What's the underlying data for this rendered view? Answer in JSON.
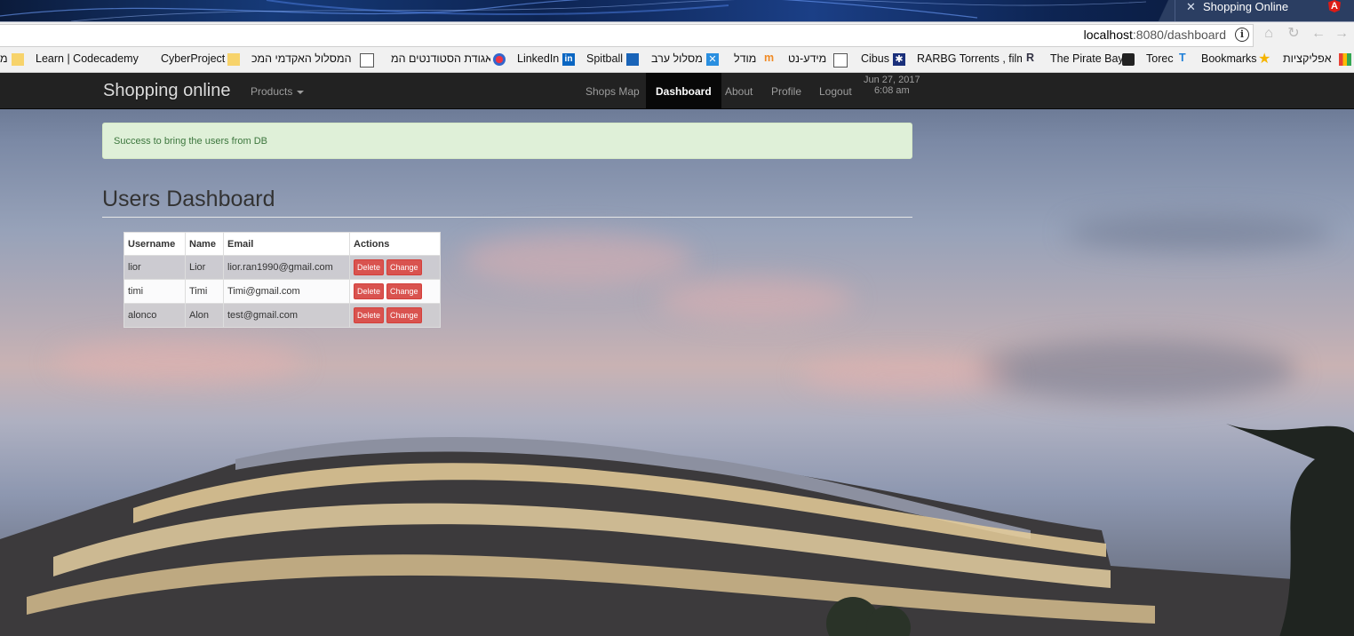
{
  "browser": {
    "tab_title": "Shopping Online",
    "tab_icon": "angular-icon",
    "url_host": "localhost",
    "url_rest": ":8080/dashboard",
    "bookmarks": [
      {
        "label": "אפליקציות",
        "icon": "apps-grid-icon"
      },
      {
        "label": "Bookmarks",
        "icon": "star-icon"
      },
      {
        "label": "Torec",
        "icon": "torec-icon"
      },
      {
        "label": "The Pirate Bay",
        "icon": "pirate-bay-icon"
      },
      {
        "label": "RARBG Torrents , film",
        "icon": "rarbg-icon"
      },
      {
        "label": "Cibus",
        "icon": "cibus-icon"
      },
      {
        "label": "מידע-נט",
        "icon": "puzzle-icon"
      },
      {
        "label": "מודל",
        "icon": "moodle-icon"
      },
      {
        "label": "מסלול ערב",
        "icon": "x-icon"
      },
      {
        "label": "Spitball",
        "icon": "spitball-icon"
      },
      {
        "label": "LinkedIn",
        "icon": "linkedin-icon"
      },
      {
        "label": "אגודת הסטודנטים המ",
        "icon": "student-icon"
      },
      {
        "label": "המסלול האקדמי המכ",
        "icon": "puzzle-icon"
      },
      {
        "label": "CyberProject",
        "icon": "folder-icon"
      },
      {
        "label": "Learn | Codecademy",
        "icon": "folder-icon"
      },
      {
        "label": "מ",
        "icon": "folder-icon"
      }
    ]
  },
  "navbar": {
    "brand": "Shopping online",
    "products": "Products",
    "links": {
      "shops_map": "Shops Map",
      "dashboard": "Dashboard",
      "about": "About",
      "profile": "Profile",
      "logout": "Logout"
    },
    "date": "Jun 27, 2017",
    "time": "6:08 am"
  },
  "alert": "Success to bring the users from DB",
  "heading": "Users Dashboard",
  "table": {
    "headers": [
      "Username",
      "Name",
      "Email",
      "Actions"
    ],
    "rows": [
      {
        "username": "lior",
        "name": "Lior",
        "email": "lior.ran1990@gmail.com"
      },
      {
        "username": "timi",
        "name": "Timi",
        "email": "Timi@gmail.com"
      },
      {
        "username": "alonco",
        "name": "Alon",
        "email": "test@gmail.com"
      }
    ],
    "delete_label": "Delete",
    "change_label": "Change"
  },
  "colors": {
    "navbar": "#222222",
    "success_bg": "#dff0d8",
    "danger": "#d9534f"
  }
}
